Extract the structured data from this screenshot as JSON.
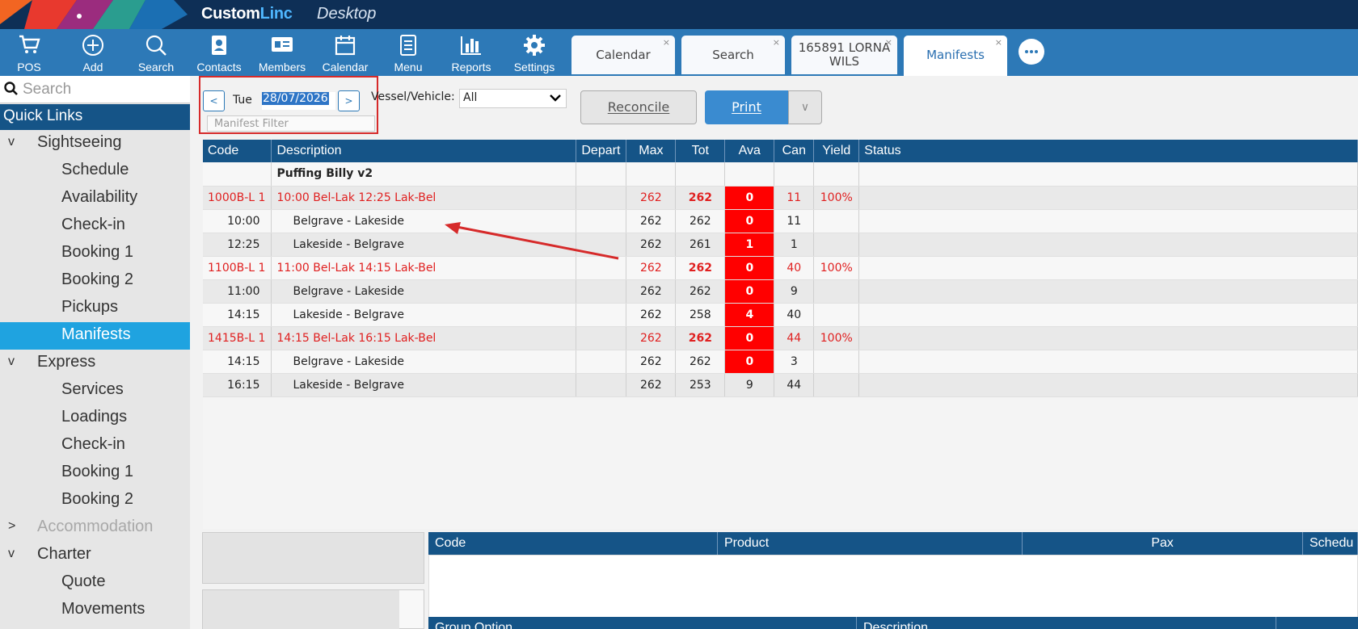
{
  "app": {
    "brand_main": "Custom",
    "brand_accent": "Linc",
    "brand_sub": "Desktop"
  },
  "toolbar": {
    "buttons": [
      {
        "label": "POS",
        "icon": "cart-icon"
      },
      {
        "label": "Add",
        "icon": "plus-circle-icon"
      },
      {
        "label": "Search",
        "icon": "search-icon"
      },
      {
        "label": "Contacts",
        "icon": "contacts-icon"
      },
      {
        "label": "Members",
        "icon": "member-card-icon"
      },
      {
        "label": "Calendar",
        "icon": "calendar-icon"
      },
      {
        "label": "Menu",
        "icon": "menu-doc-icon"
      },
      {
        "label": "Reports",
        "icon": "bar-chart-icon"
      },
      {
        "label": "Settings",
        "icon": "gear-icon"
      }
    ],
    "tabs": [
      {
        "label": "Calendar",
        "close": "×"
      },
      {
        "label": "Search",
        "close": "×"
      },
      {
        "label_line1": "165891 LORNA",
        "label_line2": "WILS",
        "close": "×"
      },
      {
        "label": "Manifests",
        "close": "×"
      }
    ],
    "more_icon": "ellipsis-icon"
  },
  "sidebar": {
    "search_placeholder": "Search",
    "quick_links": "Quick Links",
    "items": [
      {
        "label": "Sightseeing",
        "chevron": "v"
      },
      {
        "label": "Schedule"
      },
      {
        "label": "Availability"
      },
      {
        "label": "Check-in"
      },
      {
        "label": "Booking 1"
      },
      {
        "label": "Booking 2"
      },
      {
        "label": "Pickups"
      },
      {
        "label": "Manifests"
      },
      {
        "label": "Express",
        "chevron": "v"
      },
      {
        "label": "Services"
      },
      {
        "label": "Loadings"
      },
      {
        "label": "Check-in"
      },
      {
        "label": "Booking 1"
      },
      {
        "label": "Booking 2"
      },
      {
        "label": "Accommodation",
        "chevron": ">"
      },
      {
        "label": "Charter",
        "chevron": "v"
      },
      {
        "label": "Quote"
      },
      {
        "label": "Movements"
      }
    ]
  },
  "filters": {
    "prev": "<",
    "next": ">",
    "day": "Tue",
    "date": "28/07/2026",
    "manifest_filter_placeholder": "Manifest Filter",
    "vessel_label": "Vessel/Vehicle:",
    "vessel_value": "All",
    "reconcile": "Reconcile",
    "print": "Print",
    "print_dropdown": "∨"
  },
  "manifest": {
    "columns": [
      "Code",
      "Description",
      "Depart",
      "Max",
      "Tot",
      "Ava",
      "Can",
      "Yield",
      "Status"
    ],
    "group_title": "Puffing Billy v2",
    "rows": [
      {
        "code": "1000B-L 1",
        "desc": "10:00 Bel-Lak 12:25 Lak-Bel",
        "depart": "",
        "max": "262",
        "tot": "262",
        "ava": "0",
        "can": "11",
        "yield": "100%",
        "status": "",
        "kind": "parent"
      },
      {
        "code": "10:00",
        "desc": "Belgrave - Lakeside",
        "depart": "",
        "max": "262",
        "tot": "262",
        "ava": "0",
        "can": "11",
        "yield": "",
        "status": "",
        "kind": "child"
      },
      {
        "code": "12:25",
        "desc": "Lakeside - Belgrave",
        "depart": "",
        "max": "262",
        "tot": "261",
        "ava": "1",
        "can": "1",
        "yield": "",
        "status": "",
        "kind": "child"
      },
      {
        "code": "1100B-L 1",
        "desc": "11:00 Bel-Lak 14:15 Lak-Bel",
        "depart": "",
        "max": "262",
        "tot": "262",
        "ava": "0",
        "can": "40",
        "yield": "100%",
        "status": "",
        "kind": "parent"
      },
      {
        "code": "11:00",
        "desc": "Belgrave - Lakeside",
        "depart": "",
        "max": "262",
        "tot": "262",
        "ava": "0",
        "can": "9",
        "yield": "",
        "status": "",
        "kind": "child"
      },
      {
        "code": "14:15",
        "desc": "Lakeside - Belgrave",
        "depart": "",
        "max": "262",
        "tot": "258",
        "ava": "4",
        "can": "40",
        "yield": "",
        "status": "",
        "kind": "child"
      },
      {
        "code": "1415B-L 1",
        "desc": "14:15 Bel-Lak 16:15 Lak-Bel",
        "depart": "",
        "max": "262",
        "tot": "262",
        "ava": "0",
        "can": "44",
        "yield": "100%",
        "status": "",
        "kind": "parent"
      },
      {
        "code": "14:15",
        "desc": "Belgrave - Lakeside",
        "depart": "",
        "max": "262",
        "tot": "262",
        "ava": "0",
        "can": "3",
        "yield": "",
        "status": "",
        "kind": "child"
      },
      {
        "code": "16:15",
        "desc": "Lakeside - Belgrave",
        "depart": "",
        "max": "262",
        "tot": "253",
        "ava": "9",
        "can": "44",
        "yield": "",
        "status": "",
        "kind": "child"
      }
    ]
  },
  "detail_grid": {
    "columns": [
      "Code",
      "Product",
      "Pax",
      "Schedu"
    ]
  },
  "option_grid": {
    "columns": [
      "Group Option",
      "Description"
    ]
  },
  "colors": {
    "header_blue": "#155487",
    "toolbar_blue": "#2d79b7",
    "alert_red": "#ff0000",
    "active_nav": "#1fa3e0"
  }
}
